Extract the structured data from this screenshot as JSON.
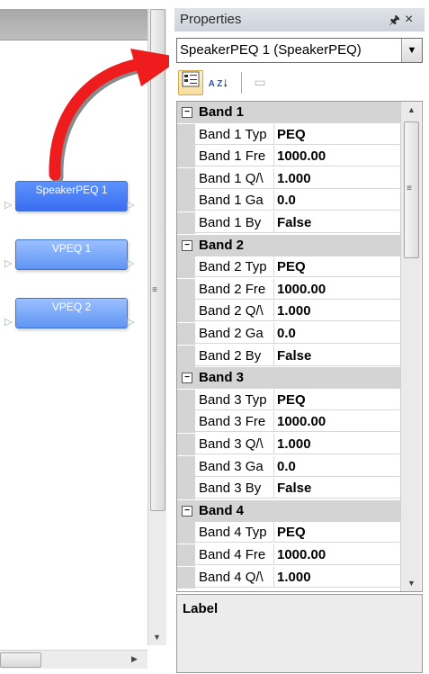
{
  "canvas": {
    "blocks": [
      {
        "label": "SpeakerPEQ 1",
        "selected": true
      },
      {
        "label": "VPEQ 1",
        "selected": false
      },
      {
        "label": "VPEQ 2",
        "selected": false
      }
    ]
  },
  "panel": {
    "title": "Properties",
    "pin_icon": "pin-icon",
    "close_icon": "close-icon",
    "object_selector": {
      "value": "SpeakerPEQ 1 (SpeakerPEQ)"
    },
    "toolbar": [
      {
        "icon": "categorized-icon",
        "active": true
      },
      {
        "icon": "alphabetical-sort-icon",
        "label": "A Z",
        "active": false
      },
      {
        "icon": "property-pages-icon",
        "active": false
      }
    ],
    "groups": [
      {
        "name": "Band 1",
        "rows": [
          {
            "name": "Band 1 Typ",
            "value": "PEQ"
          },
          {
            "name": "Band 1 Fre",
            "value": "1000.00"
          },
          {
            "name": "Band 1 Q/\\",
            "value": "1.000"
          },
          {
            "name": "Band 1 Ga",
            "value": "0.0"
          },
          {
            "name": "Band 1 By",
            "value": "False"
          }
        ]
      },
      {
        "name": "Band 2",
        "rows": [
          {
            "name": "Band 2 Typ",
            "value": "PEQ"
          },
          {
            "name": "Band 2 Fre",
            "value": "1000.00"
          },
          {
            "name": "Band 2 Q/\\",
            "value": "1.000"
          },
          {
            "name": "Band 2 Ga",
            "value": "0.0"
          },
          {
            "name": "Band 2 By",
            "value": "False"
          }
        ]
      },
      {
        "name": "Band 3",
        "rows": [
          {
            "name": "Band 3 Typ",
            "value": "PEQ"
          },
          {
            "name": "Band 3 Fre",
            "value": "1000.00"
          },
          {
            "name": "Band 3 Q/\\",
            "value": "1.000"
          },
          {
            "name": "Band 3 Ga",
            "value": "0.0"
          },
          {
            "name": "Band 3 By",
            "value": "False"
          }
        ]
      },
      {
        "name": "Band 4",
        "rows": [
          {
            "name": "Band 4 Typ",
            "value": "PEQ"
          },
          {
            "name": "Band 4 Fre",
            "value": "1000.00"
          },
          {
            "name": "Band 4 Q/\\",
            "value": "1.000"
          }
        ]
      }
    ],
    "description": {
      "title": "Label"
    }
  },
  "colors": {
    "arrow": "#ee1c1c",
    "block_selected": "#3a6df0",
    "block_normal": "#6b9cf3",
    "category_bg": "#d4d4d4"
  }
}
